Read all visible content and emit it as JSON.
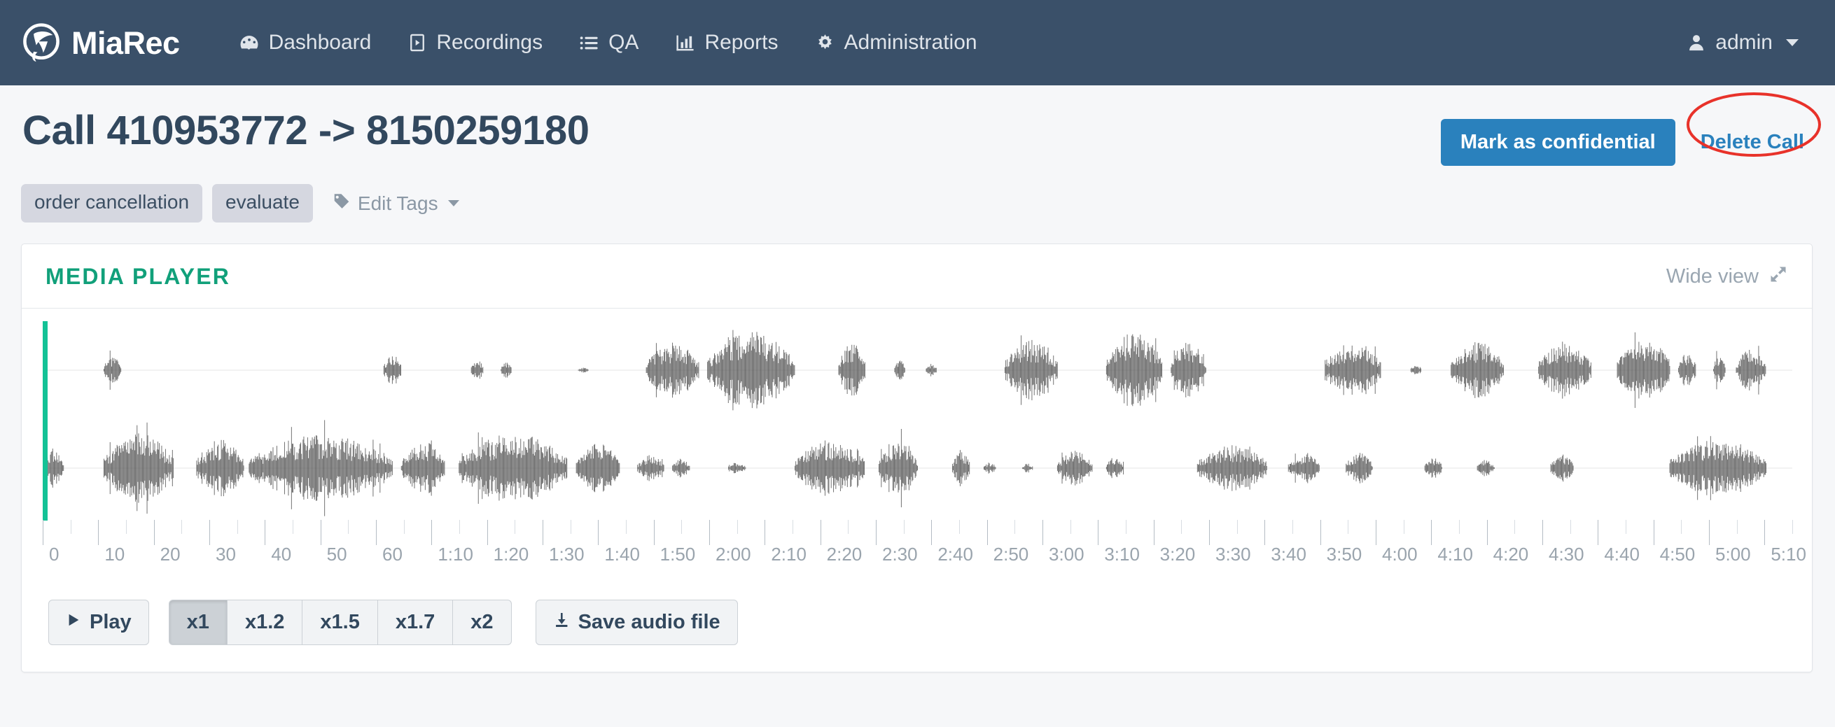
{
  "navbar": {
    "brand": "MiaRec",
    "items": [
      {
        "label": "Dashboard",
        "icon": "dashboard-icon"
      },
      {
        "label": "Recordings",
        "icon": "play-box-icon"
      },
      {
        "label": "QA",
        "icon": "list-icon"
      },
      {
        "label": "Reports",
        "icon": "bar-chart-icon"
      },
      {
        "label": "Administration",
        "icon": "gear-icon"
      }
    ],
    "user": "admin",
    "background": "#3a5069"
  },
  "header": {
    "title": "Call 410953772 -> 8150259180",
    "mark_confidential_label": "Mark as confidential",
    "delete_call_label": "Delete Call",
    "primary_color": "#2a81bd",
    "annotation_color": "#e8322a"
  },
  "tags": {
    "items": [
      "order cancellation",
      "evaluate"
    ],
    "edit_label": "Edit Tags",
    "edit_icon": "tag-icon"
  },
  "player": {
    "panel_title": "MEDIA PLAYER",
    "panel_title_color": "#11a07a",
    "wide_view_label": "Wide view",
    "wide_view_icon": "expand-icon",
    "playhead_position_label": "0",
    "playhead_color": "#13c296",
    "play_label": "Play",
    "play_icon": "play-icon",
    "speeds": [
      {
        "label": "x1",
        "active": true
      },
      {
        "label": "x1.2",
        "active": false
      },
      {
        "label": "x1.5",
        "active": false
      },
      {
        "label": "x1.7",
        "active": false
      },
      {
        "label": "x2",
        "active": false
      }
    ],
    "save_label": "Save audio file",
    "save_icon": "download-icon",
    "timeline": {
      "duration_seconds": 315,
      "minor_tick_interval_seconds": 5,
      "major_tick_interval_seconds": 10,
      "labels": [
        "0",
        "10",
        "20",
        "30",
        "40",
        "50",
        "60",
        "1:10",
        "1:20",
        "1:30",
        "1:40",
        "1:50",
        "2:00",
        "2:10",
        "2:20",
        "2:30",
        "2:40",
        "2:50",
        "3:00",
        "3:10",
        "3:20",
        "3:30",
        "3:40",
        "3:50",
        "4:00",
        "4:10",
        "4:20",
        "4:30",
        "4:40",
        "4:50",
        "5:00",
        "5:10"
      ]
    },
    "waveform": {
      "channels": 2,
      "color": "#5a5a5a",
      "top_channel_segments": [
        [
          0.035,
          0.045,
          0.3
        ],
        [
          0.195,
          0.205,
          0.34
        ],
        [
          0.245,
          0.252,
          0.22
        ],
        [
          0.262,
          0.268,
          0.16
        ],
        [
          0.306,
          0.312,
          0.05
        ],
        [
          0.345,
          0.375,
          0.55
        ],
        [
          0.38,
          0.43,
          0.8
        ],
        [
          0.455,
          0.47,
          0.58
        ],
        [
          0.487,
          0.493,
          0.22
        ],
        [
          0.505,
          0.511,
          0.15
        ],
        [
          0.55,
          0.58,
          0.62
        ],
        [
          0.608,
          0.64,
          0.78
        ],
        [
          0.645,
          0.665,
          0.6
        ],
        [
          0.733,
          0.765,
          0.62
        ],
        [
          0.782,
          0.788,
          0.12
        ],
        [
          0.805,
          0.835,
          0.58
        ],
        [
          0.855,
          0.885,
          0.6
        ],
        [
          0.9,
          0.93,
          0.7
        ],
        [
          0.935,
          0.945,
          0.4
        ],
        [
          0.955,
          0.962,
          0.35
        ],
        [
          0.968,
          0.985,
          0.45
        ]
      ],
      "bottom_channel_segments": [
        [
          0.0,
          0.012,
          0.38
        ],
        [
          0.035,
          0.075,
          0.72
        ],
        [
          0.088,
          0.115,
          0.6
        ],
        [
          0.118,
          0.2,
          0.7
        ],
        [
          0.205,
          0.23,
          0.55
        ],
        [
          0.238,
          0.3,
          0.72
        ],
        [
          0.305,
          0.33,
          0.52
        ],
        [
          0.34,
          0.355,
          0.28
        ],
        [
          0.36,
          0.37,
          0.2
        ],
        [
          0.392,
          0.402,
          0.12
        ],
        [
          0.43,
          0.47,
          0.58
        ],
        [
          0.478,
          0.5,
          0.62
        ],
        [
          0.52,
          0.53,
          0.4
        ],
        [
          0.538,
          0.545,
          0.12
        ],
        [
          0.56,
          0.566,
          0.1
        ],
        [
          0.58,
          0.6,
          0.36
        ],
        [
          0.608,
          0.618,
          0.25
        ],
        [
          0.66,
          0.7,
          0.48
        ],
        [
          0.712,
          0.73,
          0.3
        ],
        [
          0.745,
          0.76,
          0.32
        ],
        [
          0.79,
          0.8,
          0.22
        ],
        [
          0.82,
          0.83,
          0.18
        ],
        [
          0.862,
          0.875,
          0.3
        ],
        [
          0.93,
          0.985,
          0.6
        ]
      ]
    }
  }
}
